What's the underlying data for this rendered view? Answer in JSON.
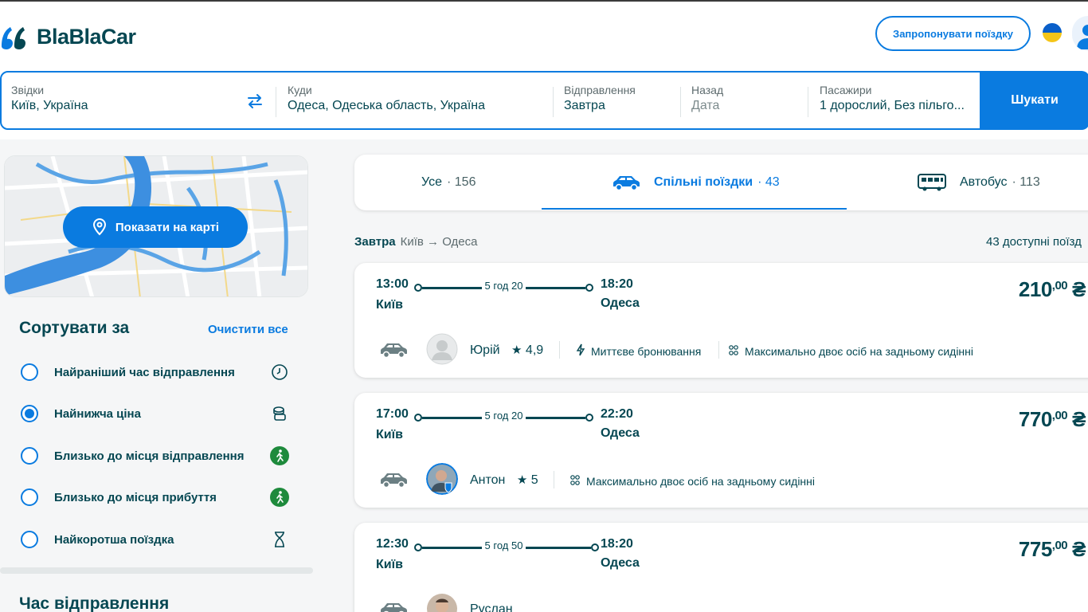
{
  "header": {
    "logo_text": "BlaBlaCar",
    "offer_ride_label": "Запропонувати поїздку",
    "colors": {
      "brand_blue": "#0a7be0",
      "text_dark": "#054752"
    }
  },
  "search": {
    "from_label": "Звідки",
    "from_value": "Київ, Україна",
    "to_label": "Куди",
    "to_value": "Одеса, Одеська область, Україна",
    "departure_label": "Відправлення",
    "departure_value": "Завтра",
    "return_label": "Назад",
    "return_value": "Дата",
    "passengers_label": "Пасажири",
    "passengers_value": "1 дорослий, Без пільго...",
    "search_button": "Шукати"
  },
  "map": {
    "show_on_map": "Показати на карті"
  },
  "sort": {
    "title": "Сортувати за",
    "clear_all": "Очистити все",
    "options": [
      {
        "label": "Найраніший час відправлення",
        "icon": "clock-icon",
        "selected": false
      },
      {
        "label": "Найнижча ціна",
        "icon": "coins-icon",
        "selected": true
      },
      {
        "label": "Близько до місця відправлення",
        "icon": "walking-icon",
        "selected": false
      },
      {
        "label": "Близько до місця прибуття",
        "icon": "walking-icon",
        "selected": false
      },
      {
        "label": "Найкоротша поїздка",
        "icon": "hourglass-icon",
        "selected": false
      }
    ]
  },
  "departure_time": {
    "title": "Час відправлення"
  },
  "tabs": [
    {
      "label": "Усе",
      "count": "· 156",
      "active": false
    },
    {
      "label": "Спільні поїздки",
      "count": "· 43",
      "active": true,
      "icon": "car-icon"
    },
    {
      "label": "Автобус",
      "count": "· 113",
      "active": false,
      "icon": "bus-icon"
    }
  ],
  "results": {
    "day": "Завтра",
    "route": "Київ → Одеса",
    "available": "43 доступні поїзд"
  },
  "rides": [
    {
      "dep_time": "13:00",
      "dep_city": "Київ",
      "duration": "5 год 20",
      "arr_time": "18:20",
      "arr_city": "Одеса",
      "price_int": "210",
      "price_dec": ",00",
      "currency": "₴",
      "driver": "Юрій",
      "rating": "4,9",
      "instant": "Миттєве бронювання",
      "max_two": "Максимально двоє осіб на задньому сидінні"
    },
    {
      "dep_time": "17:00",
      "dep_city": "Київ",
      "duration": "5 год 20",
      "arr_time": "22:20",
      "arr_city": "Одеса",
      "price_int": "770",
      "price_dec": ",00",
      "currency": "₴",
      "driver": "Антон",
      "rating": "5",
      "max_two": "Максимально двоє осіб на задньому сидінні"
    },
    {
      "dep_time": "12:30",
      "dep_city": "Київ",
      "duration": "5 год 50",
      "arr_time": "18:20",
      "arr_city": "Одеса",
      "price_int": "775",
      "price_dec": ",00",
      "currency": "₴",
      "driver": "Руслан"
    }
  ]
}
